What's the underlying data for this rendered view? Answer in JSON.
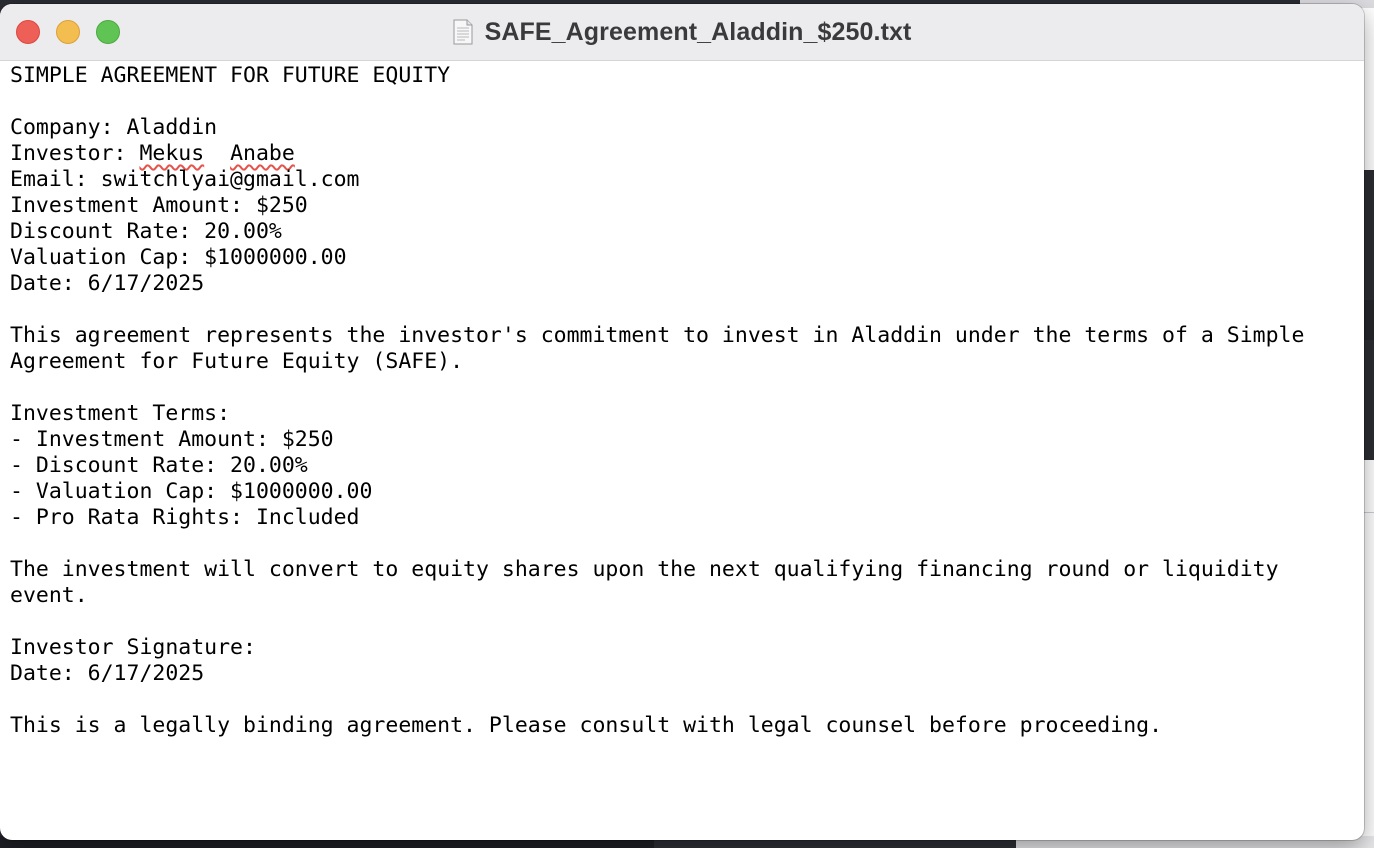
{
  "window": {
    "title": "SAFE_Agreement_Aladdin_$250.txt",
    "icon": "text-document-icon"
  },
  "document": {
    "heading": "SIMPLE AGREEMENT FOR FUTURE EQUITY",
    "company_line": "Company: Aladdin",
    "investor_prefix": "Investor: ",
    "investor_first": "Mekus",
    "investor_gap": "  ",
    "investor_last": "Anabe",
    "email_line": "Email: switchlyai@gmail.com",
    "amount_line": "Investment Amount: $250",
    "discount_line": "Discount Rate: 20.00%",
    "cap_line": "Valuation Cap: $1000000.00",
    "date_line": "Date: 6/17/2025",
    "intro_line1": "This agreement represents the investor's commitment to invest in Aladdin under the terms of a Simple",
    "intro_line2": "Agreement for Future Equity (SAFE).",
    "terms_heading": "Investment Terms:",
    "terms": [
      "- Investment Amount: $250",
      "- Discount Rate: 20.00%",
      "- Valuation Cap: $1000000.00",
      "- Pro Rata Rights: Included"
    ],
    "conversion_line1": "The investment will convert to equity shares upon the next qualifying financing round or liquidity",
    "conversion_line2": "event.",
    "signature_line": "Investor Signature:",
    "signature_date_line": "Date: 6/17/2025",
    "disclaimer": "This is a legally binding agreement. Please consult with legal counsel before proceeding."
  },
  "colors": {
    "titlebar": "#ececef",
    "close": "#ee5f57",
    "minimize": "#f4bd4f",
    "zoom": "#60c454",
    "spellcheck_underline": "#e5534b"
  }
}
